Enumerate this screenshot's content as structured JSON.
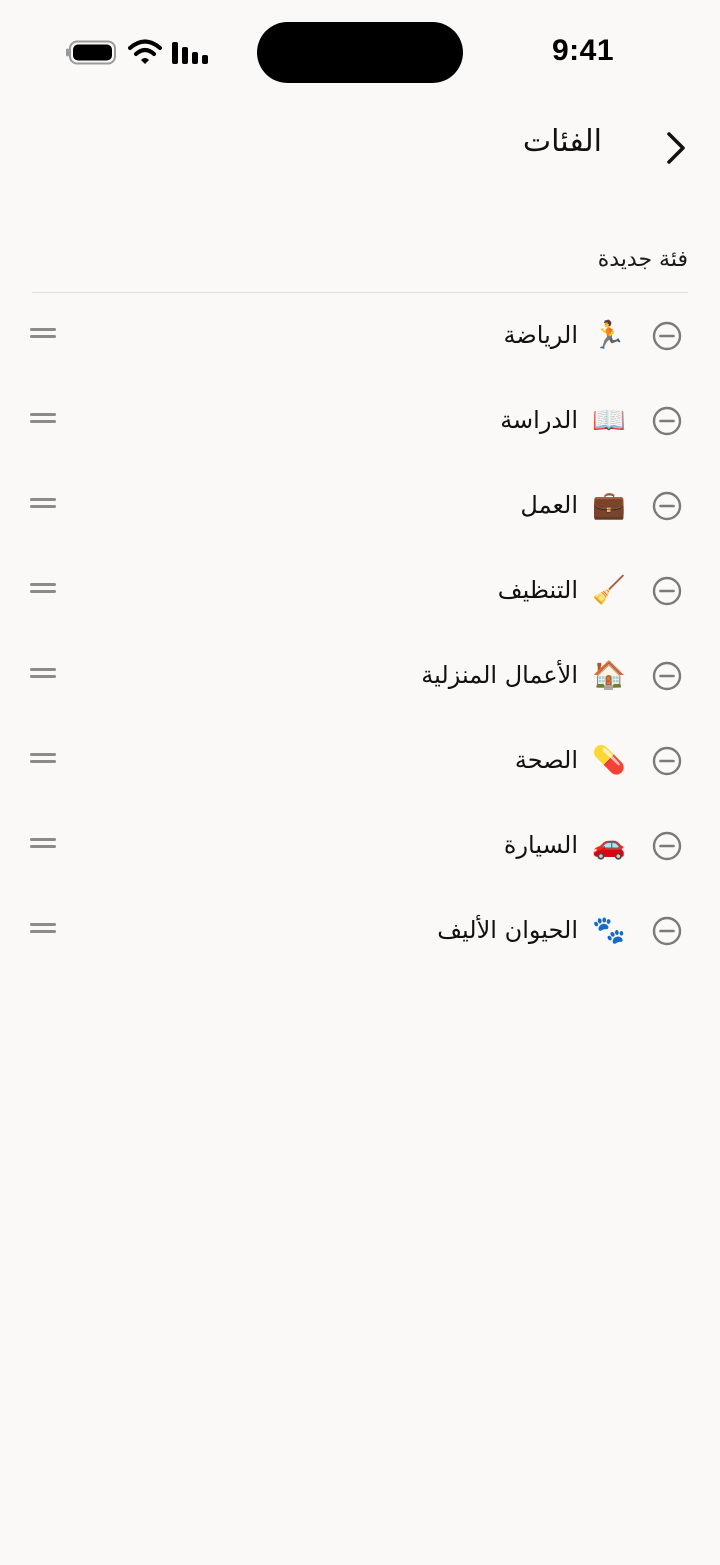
{
  "status_bar": {
    "time": "9:41"
  },
  "header": {
    "title": "الفئات",
    "back_icon": "chevron-right-icon"
  },
  "new_category": {
    "placeholder": "فئة جديدة"
  },
  "categories": [
    {
      "emoji": "🏃",
      "label": "الرياضة"
    },
    {
      "emoji": "📖",
      "label": "الدراسة"
    },
    {
      "emoji": "💼",
      "label": "العمل"
    },
    {
      "emoji": "🧹",
      "label": "التنظيف"
    },
    {
      "emoji": "🏠",
      "label": "الأعمال المنزلية"
    },
    {
      "emoji": "💊",
      "label": "الصحة"
    },
    {
      "emoji": "🚗",
      "label": "السيارة"
    },
    {
      "emoji": "🐾",
      "label": "الحيوان الأليف"
    }
  ],
  "colors": {
    "background": "#faf9f8",
    "icon_gray": "#7a7a7a",
    "divider": "#e2e0dd"
  }
}
